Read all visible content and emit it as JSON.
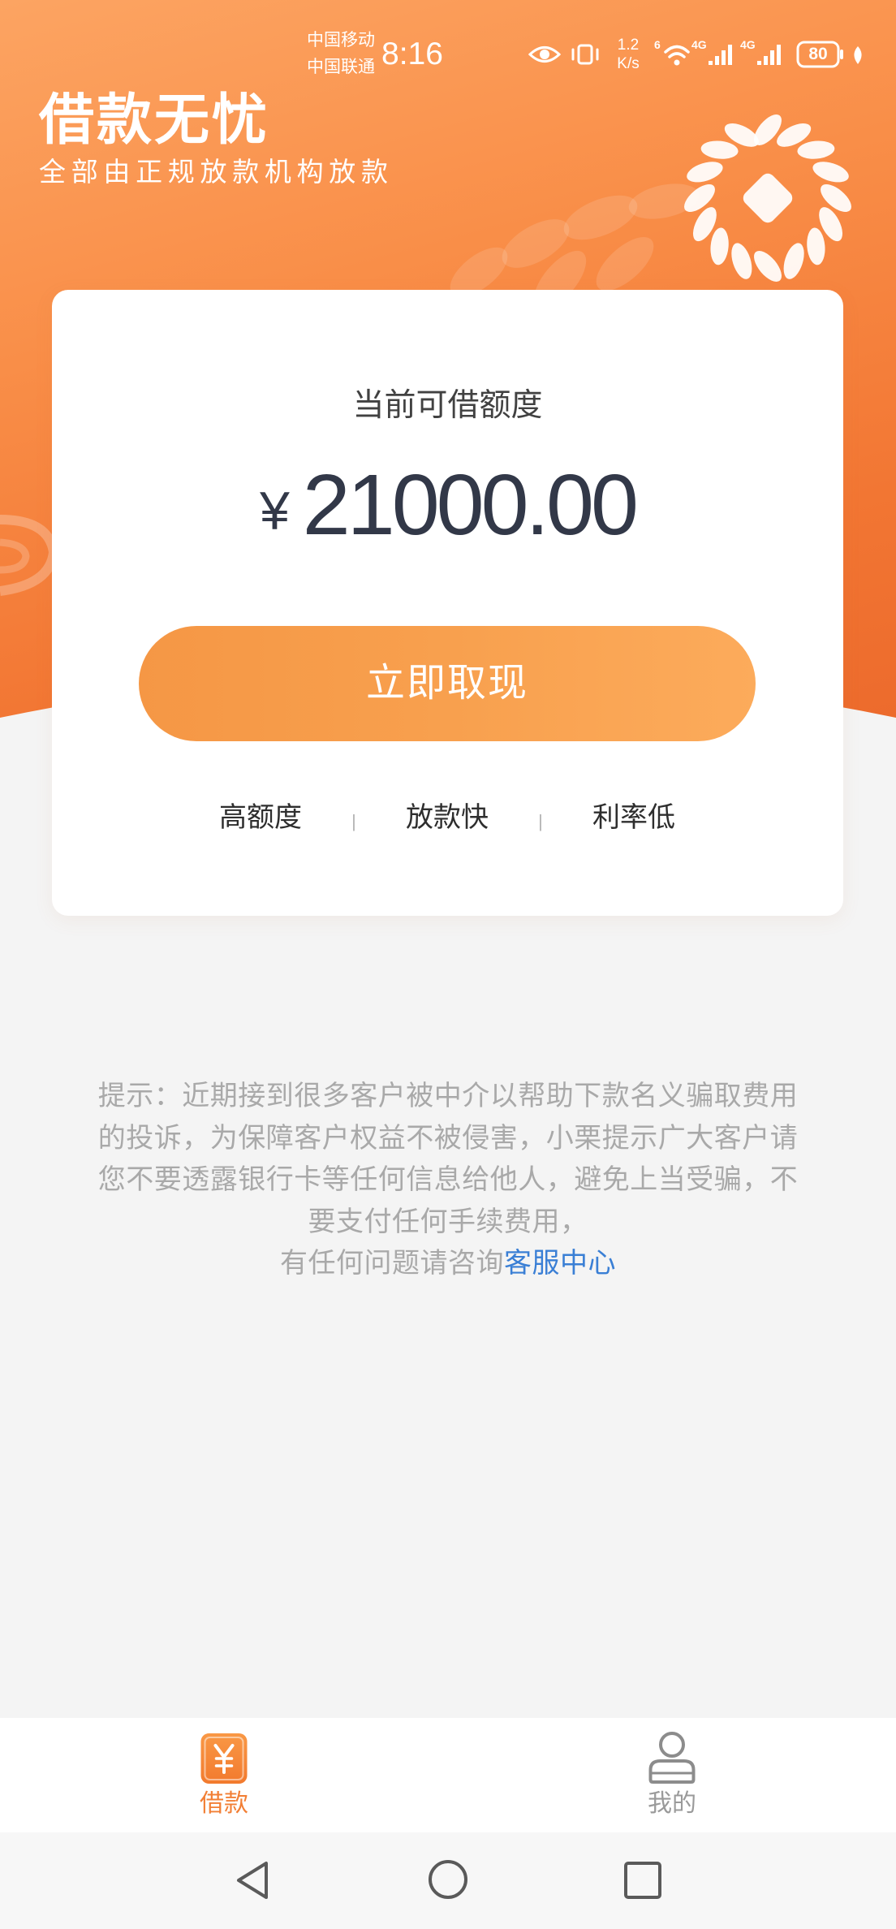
{
  "status_bar": {
    "carrier_primary": "中国移动",
    "carrier_secondary": "中国联通",
    "time": "8:16",
    "net_speed_value": "1.2",
    "net_speed_unit": "K/s",
    "wifi_badge": "6",
    "signal_1_badge": "4G",
    "signal_2_badge": "4G",
    "battery_level": "80",
    "icons": [
      "eye-icon",
      "vibrate-icon",
      "wifi-icon",
      "signal-icon",
      "signal-icon",
      "battery-icon",
      "leaf-icon"
    ]
  },
  "header": {
    "title": "借款无忧",
    "subtitle": "全部由正规放款机构放款",
    "decoration_icons": [
      "coin-wreath-icon",
      "wheat-leaves-icon",
      "swirl-icon"
    ]
  },
  "credit_card": {
    "label": "当前可借额度",
    "currency_symbol": "¥",
    "amount": "21000.00",
    "withdraw_button": "立即取现",
    "features": [
      "高额度",
      "放款快",
      "利率低"
    ],
    "separator": "|"
  },
  "notice": {
    "lines": [
      "提示：近期接到很多客户被中介以帮助下款名义骗取费用",
      "的投诉，为保障客户权益不被侵害，小栗提示广大客户请",
      "您不要透露银行卡等任何信息给他人，避免上当受骗，不",
      "要支付任何手续费用，"
    ],
    "contact_prefix": "有任何问题请咨询",
    "contact_link": "客服中心"
  },
  "tab_bar": {
    "tabs": [
      {
        "label": "借款",
        "icon": "yuan-icon",
        "active": true
      },
      {
        "label": "我的",
        "icon": "user-icon",
        "active": false
      }
    ]
  },
  "system_nav": {
    "icons": [
      "back-icon",
      "home-icon",
      "recents-icon"
    ]
  },
  "colors": {
    "brand_orange": "#f7853e",
    "header_gradient_top": "#fca462",
    "header_gradient_bottom": "#ec6a2c",
    "button_gradient_left": "#f59745",
    "button_gradient_right": "#fcab5b",
    "amount_text": "#323848",
    "notice_text": "#a9a9a9",
    "link_blue": "#3a7fd5",
    "tab_active": "#f27f35",
    "tab_inactive": "#9a9a9a",
    "page_background": "#f4f4f4"
  }
}
